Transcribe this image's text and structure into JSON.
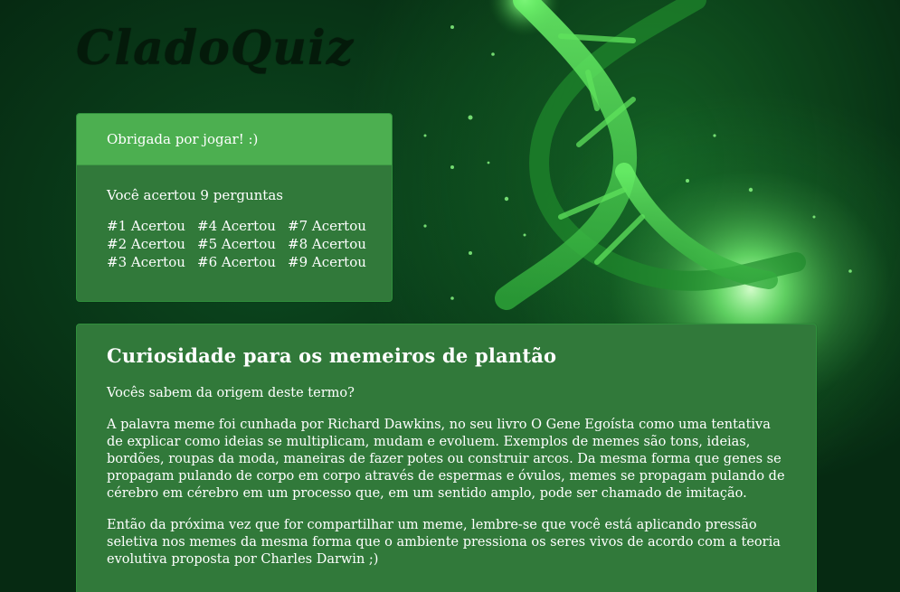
{
  "brand": {
    "logo_text": "CladoQuiz"
  },
  "result": {
    "header": "Obrigada por jogar! :)",
    "score": "Você acertou 9 perguntas",
    "answers": [
      "#1 Acertou",
      "#4 Acertou",
      "#7 Acertou",
      "#2 Acertou",
      "#5 Acertou",
      "#8 Acertou",
      "#3 Acertou",
      "#6 Acertou",
      "#9 Acertou"
    ]
  },
  "curiosity": {
    "title": "Curiosidade para os memeiros de plantão",
    "paragraphs": [
      "Vocês sabem da origem deste termo?",
      "A palavra meme foi cunhada por Richard Dawkins, no seu livro O Gene Egoísta como uma tentativa de explicar como ideias se multiplicam, mudam e evoluem. Exemplos de memes são tons, ideias, bordões, roupas da moda, maneiras de fazer potes ou construir arcos. Da mesma forma que genes se propagam pulando de corpo em corpo através de espermas e óvulos, memes se propagam pulando de cérebro em cérebro em um processo que, em um sentido amplo, pode ser chamado de imitação.",
      "Então da próxima vez que for compartilhar um meme, lembre-se que você está aplicando pressão seletiva nos memes da mesma forma que o ambiente pressiona os seres vivos de acordo com a teoria evolutiva proposta por Charles Darwin ;)"
    ]
  },
  "colors": {
    "page_background": "#052610",
    "card_background": "#31793a",
    "card_header": "#4caf50",
    "logo": "#041a0a",
    "helix_glow": "#7dff7a"
  },
  "decoration": {
    "background_image": "dna-helix"
  }
}
